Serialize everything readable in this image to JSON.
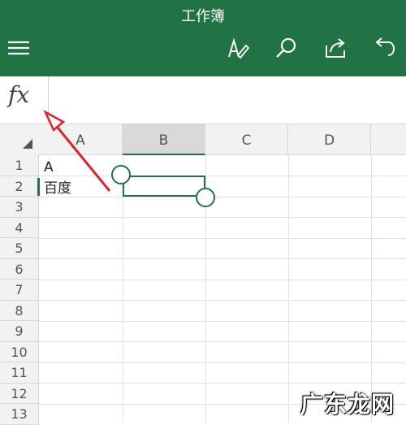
{
  "app": {
    "title": "工作簿"
  },
  "toolbar": {
    "menu_icon": "hamburger-icon",
    "icons": [
      "pen-icon",
      "search-icon",
      "share-icon",
      "undo-icon"
    ]
  },
  "formula_bar": {
    "label": "fx",
    "value": ""
  },
  "grid": {
    "columns": [
      "A",
      "B",
      "C",
      "D"
    ],
    "rows": [
      "1",
      "2",
      "3",
      "4",
      "5",
      "6",
      "7",
      "8",
      "9",
      "10",
      "11",
      "12",
      "13"
    ],
    "selected_column": "B",
    "cells": {
      "A1": "A",
      "A2": "百度"
    }
  },
  "watermark": "广东龙网",
  "colors": {
    "brand": "#217346",
    "annotation_arrow": "#d9232d"
  }
}
